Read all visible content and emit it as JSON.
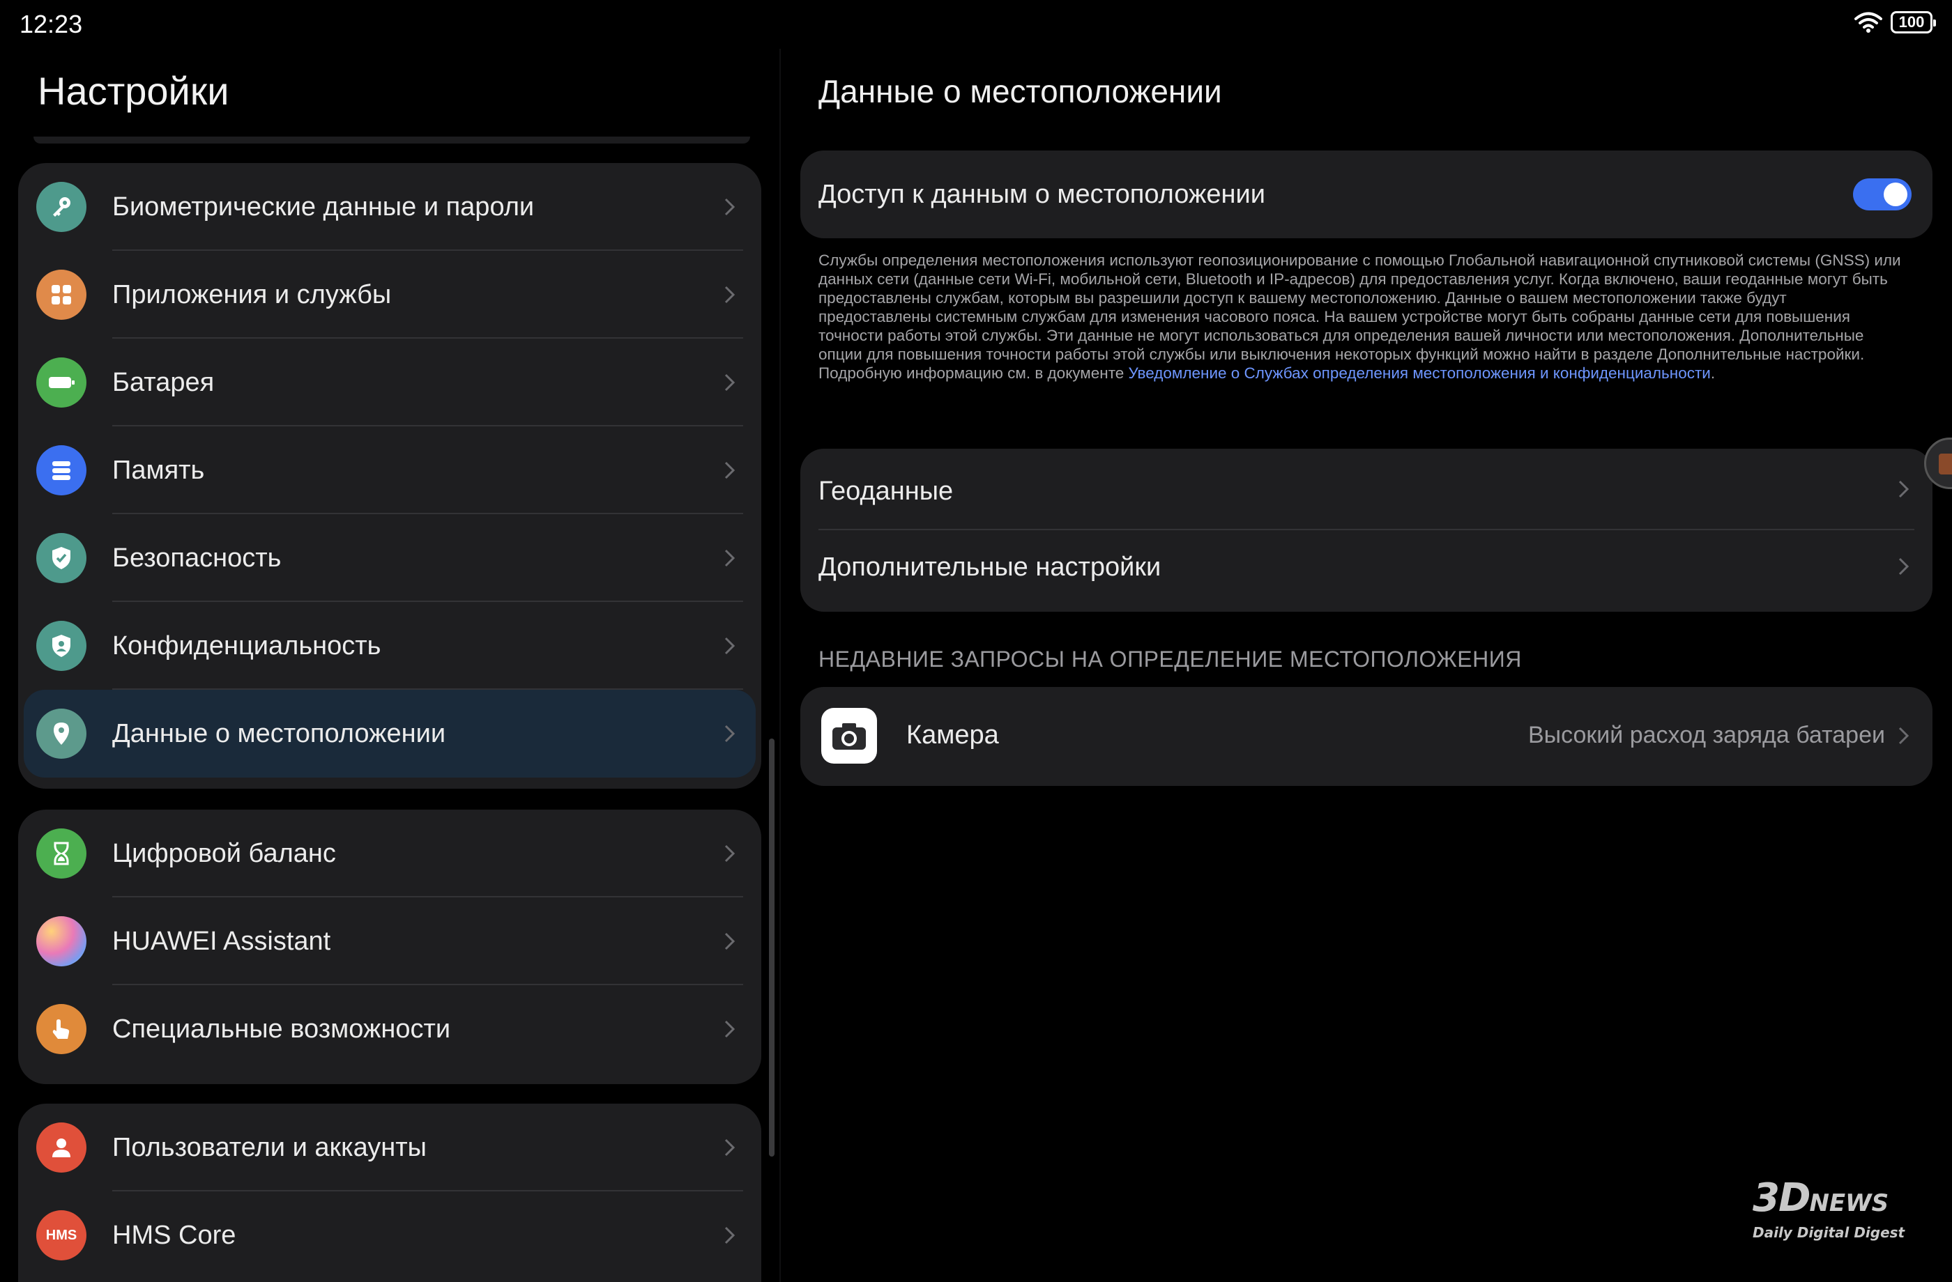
{
  "status_bar": {
    "time": "12:23",
    "battery": "100"
  },
  "left": {
    "title": "Настройки",
    "groups": [
      [
        {
          "label": "Биометрические данные и пароли",
          "icon": "key-icon",
          "color": "#4e9a8c"
        },
        {
          "label": "Приложения и службы",
          "icon": "apps-grid-icon",
          "color": "#e08a4a"
        },
        {
          "label": "Батарея",
          "icon": "battery-icon",
          "color": "#4caf50"
        },
        {
          "label": "Память",
          "icon": "storage-icon",
          "color": "#3b6ff0"
        },
        {
          "label": "Безопасность",
          "icon": "shield-check-icon",
          "color": "#4e9a8c"
        },
        {
          "label": "Конфиденциальность",
          "icon": "privacy-shield-icon",
          "color": "#4e9a8c"
        },
        {
          "label": "Данные о местоположении",
          "icon": "location-pin-icon",
          "color": "#5d9a8c",
          "selected": true
        }
      ],
      [
        {
          "label": "Цифровой баланс",
          "icon": "hourglass-icon",
          "color": "#4caf50"
        },
        {
          "label": "HUAWEI Assistant",
          "icon": "assistant-icon",
          "color": "#c88ae0"
        },
        {
          "label": "Специальные возможности",
          "icon": "hand-touch-icon",
          "color": "#e08a3a"
        }
      ],
      [
        {
          "label": "Пользователи и аккаунты",
          "icon": "user-icon",
          "color": "#e0503a"
        },
        {
          "label": "HMS Core",
          "icon": "hms-icon",
          "color": "#e0503a",
          "icon_text": "HMS"
        }
      ]
    ]
  },
  "right": {
    "title": "Данные о местоположении",
    "access": {
      "label": "Доступ к данным о местоположении",
      "enabled": true,
      "accent": "#3a6ff0"
    },
    "description": "Службы определения местоположения используют геопозиционирование с помощью Глобальной навигационной спутниковой системы (GNSS) или данных сети (данные сети Wi-Fi, мобильной сети, Bluetooth и IP-адресов) для предоставления услуг. Когда включено, ваши геоданные могут быть предоставлены службам, которым вы разрешили доступ к вашему местоположению. Данные о вашем местоположении также будут предоставлены системным службам для изменения часового пояса. На вашем устройстве могут быть собраны данные сети для повышения точности работы этой службы. Эти данные не могут использоваться для определения вашей личности или местоположения. Дополнительные опции для повышения точности работы этой службы или выключения некоторых функций можно найти в разделе Дополнительные настройки. Подробную информацию см. в документе ",
    "description_link": "Уведомление о Службах определения местоположения и конфиденциальности",
    "description_end": ".",
    "menu": [
      {
        "label": "Геоданные"
      },
      {
        "label": "Дополнительные настройки"
      }
    ],
    "recent_header": "НЕДАВНИЕ ЗАПРОСЫ НА ОПРЕДЕЛЕНИЕ МЕСТОПОЛОЖЕНИЯ",
    "recent": [
      {
        "app": "Камера",
        "status": "Высокий расход заряда батареи",
        "icon": "camera-icon"
      }
    ]
  },
  "watermark": {
    "brand": "3D",
    "brand_suffix": "NEWS",
    "tagline": "Daily Digital Digest"
  }
}
